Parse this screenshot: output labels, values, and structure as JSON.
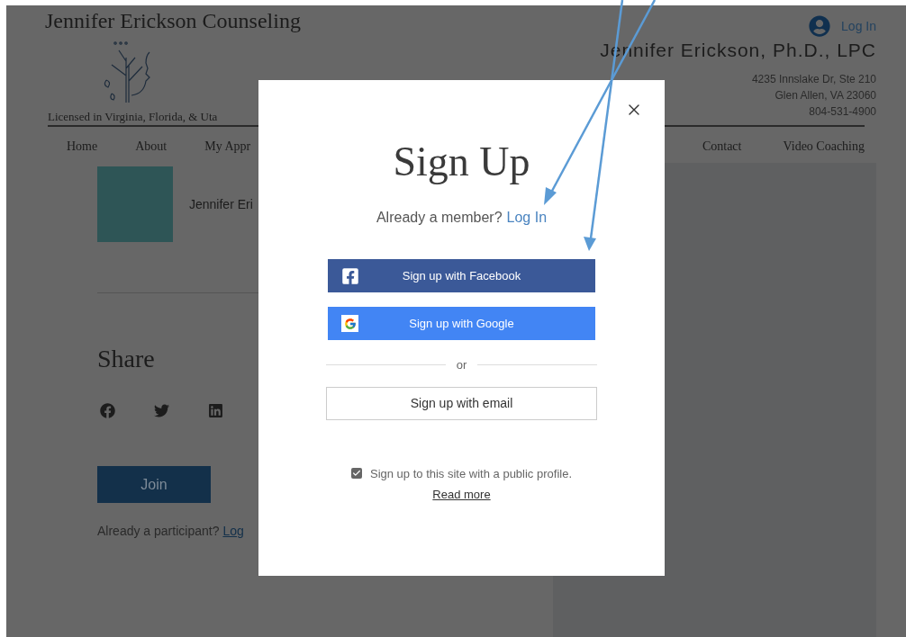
{
  "header": {
    "title": "Jennifer Erickson Counseling",
    "tagline": "Licensed in Virginia, Florida, & Uta",
    "login": "Log In",
    "name": "Jennifer Erickson, Ph.D., LPC",
    "address": [
      "4235 Innslake Dr, Ste 210",
      "Glen Allen, VA 23060",
      "804-531-4900"
    ]
  },
  "nav_left": [
    {
      "label": "Home"
    },
    {
      "label": "About"
    },
    {
      "label": "My Appr"
    }
  ],
  "nav_right": [
    {
      "label": "Contact"
    },
    {
      "label": "Video Coaching"
    }
  ],
  "profile": {
    "name": "Jennifer Eri"
  },
  "share": {
    "heading": "Share"
  },
  "join_button": "Join",
  "participant_prompt": {
    "text": "Already a participant?",
    "link": "Log"
  },
  "dialog": {
    "title": "Sign Up",
    "member_prompt": "Already a member?",
    "login_link": "Log In",
    "buttons": [
      {
        "kind": "facebook",
        "label": "Sign up with Facebook"
      },
      {
        "kind": "google",
        "label": "Sign up with Google"
      }
    ],
    "divider": "or",
    "email_button": "Sign up with email",
    "public_profile": {
      "label": "Sign up to this site with a public profile.",
      "checked": true
    },
    "read_more": "Read more"
  }
}
